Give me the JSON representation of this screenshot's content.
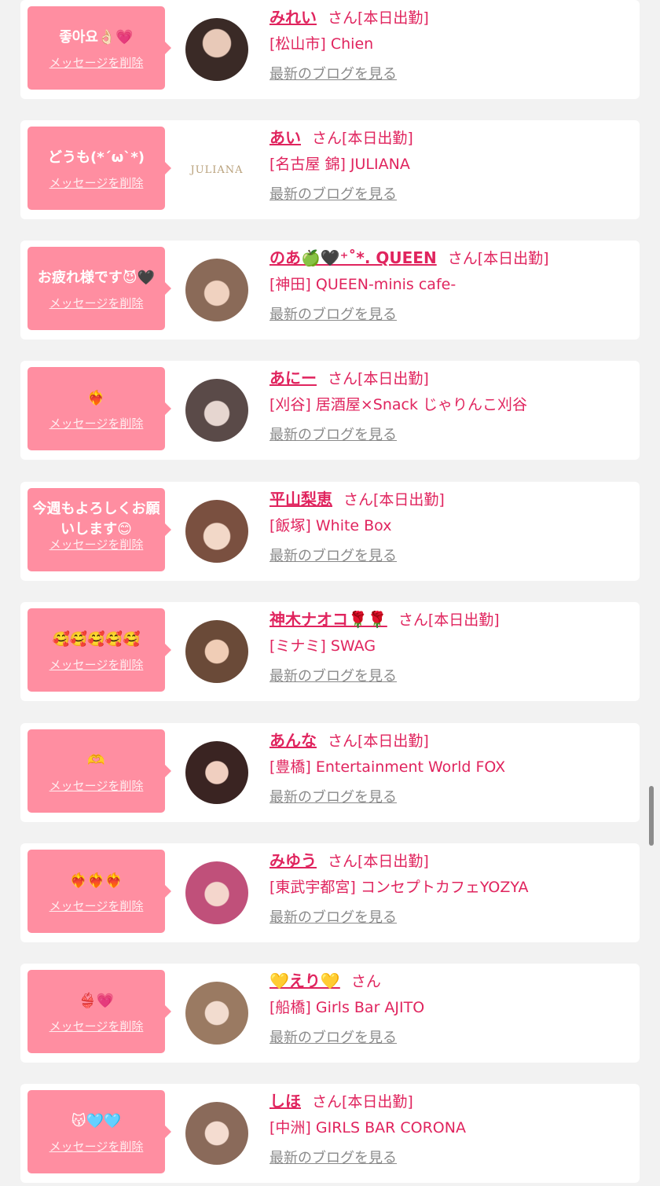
{
  "ui": {
    "delete_label": "メッセージを削除",
    "blog_label": "最新のブログを見る",
    "honorific": "さん"
  },
  "colors": {
    "bubble": "#ff8ea1",
    "accent": "#e0245e",
    "link_gray": "#8a8a8a",
    "page_bg": "#f2f2f2"
  },
  "messages": [
    {
      "message": "좋아요👌🏻💗",
      "name": "みれい",
      "status": "[本日出勤]",
      "shop": "[松山市] Chien"
    },
    {
      "message": "どうも(*´ω`*)",
      "name": "あい",
      "status": "[本日出勤]",
      "shop": "[名古屋 錦] JULIANA",
      "logo_text": "JULIANA"
    },
    {
      "message": "お疲れ様です😈🖤",
      "name": "のあ🍏🖤⁺˚*. QUEEN",
      "status": "[本日出勤]",
      "shop": "[神田] QUEEN-minis cafe-"
    },
    {
      "message": "❤️‍🔥",
      "name": "あにー",
      "status": "[本日出勤]",
      "shop": "[刈谷] 居酒屋×Snack じゃりんこ刈谷"
    },
    {
      "message": "今週もよろしくお願いします😊",
      "name": "平山梨恵",
      "status": "[本日出勤]",
      "shop": "[飯塚] White Box"
    },
    {
      "message": "🥰🥰🥰🥰🥰",
      "name": "神木ナオコ🌹🌹",
      "status": "[本日出勤]",
      "shop": "[ミナミ] SWAG"
    },
    {
      "message": "🫶",
      "name": "あんな",
      "status": "[本日出勤]",
      "shop": "[豊橋] Entertainment World FOX"
    },
    {
      "message": "❤️‍🔥❤️‍🔥❤️‍🔥",
      "name": "みゆう",
      "status": "[本日出勤]",
      "shop": "[東武宇都宮] コンセプトカフェYOZYA"
    },
    {
      "message": "👙💗",
      "name": "💛えり💛",
      "status": "",
      "shop": "[船橋] Girls Bar AJITO"
    },
    {
      "message": "😽🩵🩵",
      "name": "しほ",
      "status": "[本日出勤]",
      "shop": "[中洲] GIRLS BAR CORONA"
    }
  ]
}
